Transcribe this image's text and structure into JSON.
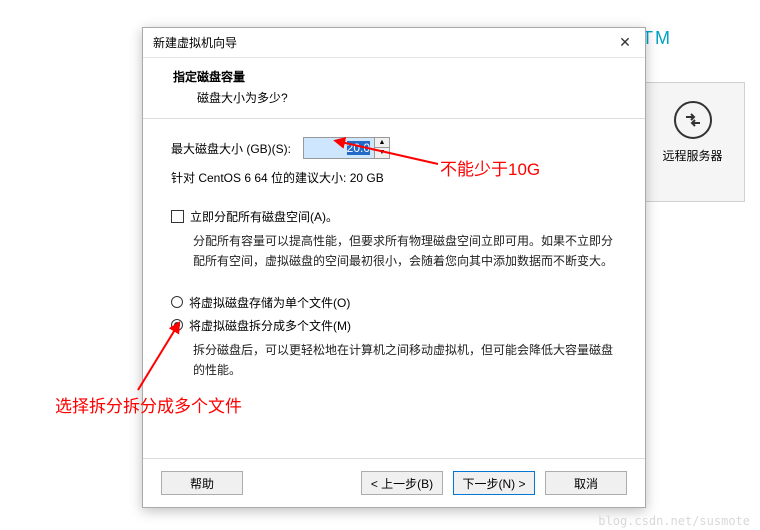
{
  "bg": {
    "tm": "TM",
    "card_label": "远程服务器"
  },
  "dialog": {
    "title": "新建虚拟机向导",
    "header_title": "指定磁盘容量",
    "header_sub": "磁盘大小为多少?",
    "size_label": "最大磁盘大小 (GB)(S):",
    "size_value": "20.0",
    "suggest": "针对 CentOS 6 64 位的建议大小: 20 GB",
    "alloc_label": "立即分配所有磁盘空间(A)。",
    "alloc_desc": "分配所有容量可以提高性能，但要求所有物理磁盘空间立即可用。如果不立即分配所有空间，虚拟磁盘的空间最初很小，会随着您向其中添加数据而不断变大。",
    "radio_single": "将虚拟磁盘存储为单个文件(O)",
    "radio_multi": "将虚拟磁盘拆分成多个文件(M)",
    "split_desc": "拆分磁盘后，可以更轻松地在计算机之间移动虚拟机，但可能会降低大容量磁盘的性能。"
  },
  "buttons": {
    "help": "帮助",
    "back": "< 上一步(B)",
    "next": "下一步(N) >",
    "cancel": "取消"
  },
  "anno": {
    "a1": "不能少于10G",
    "a2": "选择拆分拆分成多个文件"
  },
  "watermark": "blog.csdn.net/susmote"
}
